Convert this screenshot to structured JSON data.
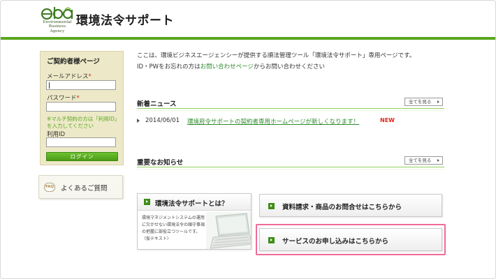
{
  "header": {
    "logo_letters": "eba",
    "logo_sub": [
      "Environmental",
      "Business",
      "Agency"
    ],
    "site_title": "環境法令サポート"
  },
  "login": {
    "title": "ご契約者様ページ",
    "email_label": "メールアドレス",
    "password_label": "パスワード",
    "required_mark": "*",
    "note": "※マルチ契約の方は「利用ID」を入力してください",
    "user_id_label": "利用ID",
    "login_button": "ログイン",
    "email_value": "",
    "password_value": "",
    "user_id_value": ""
  },
  "faq": {
    "icon_text": "FAQ",
    "label": "よくあるご質問"
  },
  "intro": {
    "line1": "ここは、環境ビジネスエージェンシーが提供する順法管理ツール「環境法令サポート」専用ページです。",
    "line2_prefix": "ID・PWをお忘れの方は",
    "line2_link": "お問い合わせページ",
    "line2_suffix": "からお問い合わせください"
  },
  "news": {
    "title": "新着ニュース",
    "see_all": "全てを見る",
    "items": [
      {
        "date": "2014/06/01",
        "text": "環境府令サポートの契約者専用ホームページが新しくなります！",
        "badge": "NEW"
      }
    ]
  },
  "notices": {
    "title": "重要なお知らせ",
    "see_all": "全てを見る"
  },
  "about": {
    "title": "環境法令サポートとは？",
    "text": "環境マネジメントシステムの運用に欠かせない環境法令の順守事項の把握に部役立つツールです。（仮テキスト）"
  },
  "buttons": {
    "request": "資料請求・商品のお問合せはこちらから",
    "apply": "サービスのお申し込みはこちらから"
  },
  "colors": {
    "brand_green": "#5aa61e",
    "link_green": "#2c8a2a",
    "new_red": "#e0261c",
    "highlight_pink": "#f06b97",
    "sidebar_bg": "#ede9c8"
  }
}
